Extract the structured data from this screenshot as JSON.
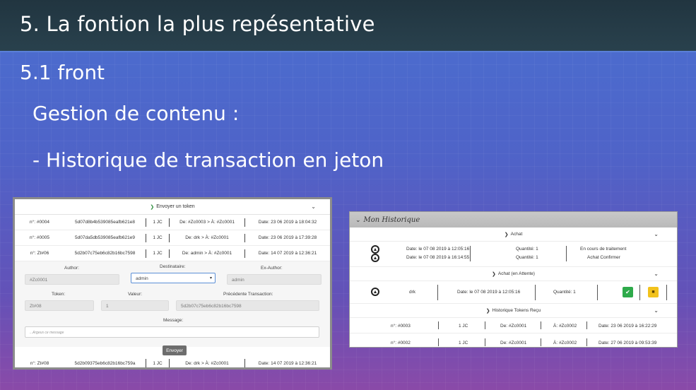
{
  "slide": {
    "title": "5. La fontion la plus repésentative",
    "subtitle": "5.1 front",
    "line1": "Gestion de contenu :",
    "line2": "- Historique de transaction en jeton"
  },
  "left_screenshot": {
    "accordion_label": "Envoyer un token",
    "rows": [
      {
        "num": "n°: #0004",
        "hash": "5d07d8b4b539085eafb621e8",
        "value": "1 JC",
        "dir": "De: #Zc0003 > À: #Zc0001",
        "date": "Date: 23 06 2019 à 18:04:32"
      },
      {
        "num": "n°: #0005",
        "hash": "5d07da5db539085eafb621e9",
        "value": "1 JC",
        "dir": "De: drk > À: #Zc0001",
        "date": "Date: 23 06 2019 à 17:39:28"
      },
      {
        "num": "n°: Zt#06",
        "hash": "5d2b07c75eb6c82b16bc7598",
        "value": "1 JC",
        "dir": "De: admin > À: #Zc0001",
        "date": "Date: 14 07 2019 à 12:36:21"
      }
    ],
    "form": {
      "author_label": "Author:",
      "author_value": "#Zc0001",
      "dest_label": "Destinataire:",
      "dest_value": "admin",
      "exauthor_label": "Ex-Author:",
      "exauthor_value": "admin",
      "token_label": "Token:",
      "token_value": "Zt#08",
      "valeur_label": "Valeur:",
      "valeur_value": "1",
      "prev_label": "Précédente Transaction:",
      "prev_value": "5d2b07c75eb6c82b16bc7598",
      "message_label": "Message:",
      "message_placeholder": "...Argeus ce message",
      "send_label": "Envoyer"
    },
    "last_row": {
      "num": "n°: Zt#08",
      "hash": "5d2b09375eb6c82b16bc759a",
      "value": "1 JC",
      "dir": "De: drk > À: #Zc0001",
      "date": "Date: 14 07 2019 à 12:36:21"
    }
  },
  "right_screenshot": {
    "header": "Mon Historique",
    "achat_label": "Achat",
    "achat_row": {
      "date1": "Date: le 07 08 2019 à 12:05:16",
      "date2": "Date: le 07 08 2019 à 16:14:55",
      "qty1": "Quantité: 1",
      "qty2": "Quantité: 1",
      "status1": "En cours de traitement",
      "status2": "Achat Confirmer"
    },
    "attente_label": "Achat (en Attente)",
    "attente_row": {
      "name": "drk",
      "date": "Date: le 07 08 2019 à 12:05:16",
      "qty": "Quantité: 1"
    },
    "tokens_label": "Historique Tokens Reçu",
    "tokens_rows": [
      {
        "num": "n°: #0003",
        "value": "1 JC",
        "from": "De: #Zc0001",
        "to": "À: #Zc0002",
        "date": "Date: 23 06 2019 à 16:22:29"
      },
      {
        "num": "n°: #0002",
        "value": "1 JC",
        "from": "De: #Zc0001",
        "to": "À: #Zc0002",
        "date": "Date: 27 06 2019 à 09:53:39"
      }
    ]
  },
  "colors": {
    "title_bar": "#213540",
    "accent_green": "#2eaa4a",
    "accent_yellow": "#f2c21c"
  }
}
